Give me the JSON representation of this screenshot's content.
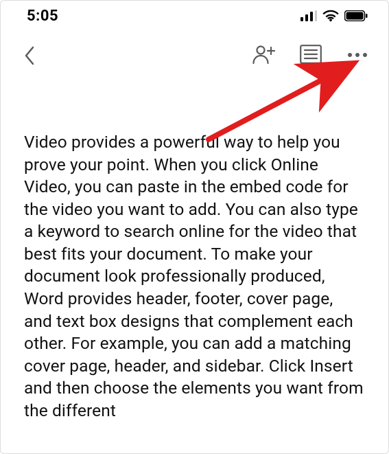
{
  "status_bar": {
    "time": "5:05"
  },
  "toolbar": {
    "back_label": "Back",
    "share_label": "Share",
    "outline_label": "Document outline",
    "more_label": "More options"
  },
  "document": {
    "body": "Video provides a powerful way to help you prove your point. When you click Online Video, you can paste in the embed code for the video you want to add. You can also type a keyword to search online for the video that best fits your document. To make your document look professionally produced, Word provides header, footer, cover page, and text box designs that complement each other. For example, you can add a matching cover page, header, and sidebar. Click Insert and then choose the elements you want from the different"
  },
  "annotation": {
    "arrow_color": "#e11d1d"
  }
}
